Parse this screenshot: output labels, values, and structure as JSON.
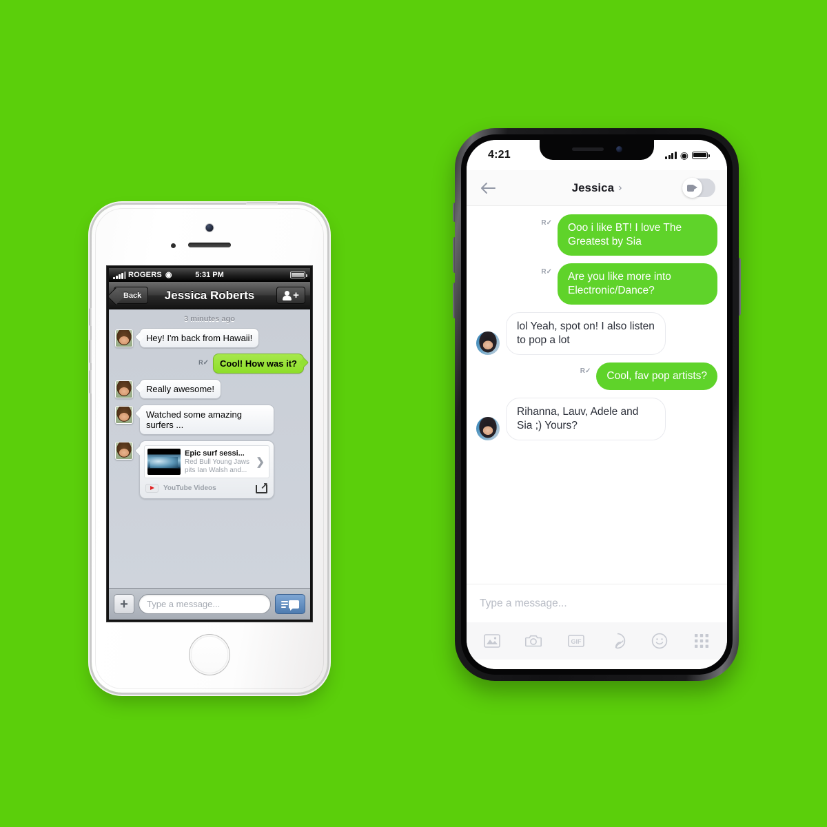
{
  "canvas": {
    "background_color": "#5bcf0b"
  },
  "phone_old": {
    "device_name": "iphone-5s-white",
    "status_bar": {
      "carrier": "ROGERS",
      "wifi_icon": "wifi-icon",
      "time": "5:31 PM",
      "signal_icon": "cellular-signal-icon",
      "battery_icon": "battery-icon"
    },
    "nav": {
      "back_label": "Back",
      "title": "Jessica Roberts",
      "add_contact_icon": "add-person-icon"
    },
    "chat": {
      "timestamp": "3 minutes ago",
      "read_receipt_label": "R",
      "messages": [
        {
          "from": "them",
          "text": "Hey! I'm back from Hawaii!"
        },
        {
          "from": "me",
          "text": "Cool! How was it?"
        },
        {
          "from": "them",
          "text": "Really awesome!"
        },
        {
          "from": "them",
          "text": "Watched some amazing surfers ..."
        }
      ],
      "card": {
        "title": "Epic surf sessi...",
        "desc_line1": "Red Bull Young Jaws",
        "desc_line2": "pits Ian Walsh and...",
        "source": "YouTube Videos",
        "chevron_icon": "chevron-right-icon",
        "play_icon": "youtube-play-icon",
        "share_icon": "share-icon"
      }
    },
    "input_bar": {
      "attach_label": "+",
      "placeholder": "Type a message...",
      "send_icon": "send-message-icon"
    }
  },
  "phone_new": {
    "device_name": "iphone-x-black",
    "status_bar": {
      "time": "4:21",
      "signal_icon": "cellular-signal-icon",
      "wifi_icon": "wifi-icon",
      "battery_icon": "battery-icon"
    },
    "nav": {
      "back_icon": "back-arrow-icon",
      "title": "Jessica",
      "chevron": "›",
      "video_toggle_icon": "video-call-icon",
      "video_toggle_state": "off"
    },
    "chat": {
      "read_receipt_label": "R",
      "messages": [
        {
          "from": "me",
          "text": "Ooo i like BT! I love The Greatest by Sia"
        },
        {
          "from": "me",
          "text": "Are you like more into Electronic/Dance?"
        },
        {
          "from": "them",
          "text": "lol Yeah, spot on! I also listen to pop a lot"
        },
        {
          "from": "me",
          "text": "Cool, fav pop artists?"
        },
        {
          "from": "them",
          "text": "Rihanna, Lauv, Adele and Sia ;) Yours?"
        }
      ]
    },
    "input_bar": {
      "placeholder": "Type a message..."
    },
    "toolbar": {
      "items": [
        {
          "icon": "photo-gallery-icon",
          "label": ""
        },
        {
          "icon": "camera-icon",
          "label": ""
        },
        {
          "icon": "gif-icon",
          "label": "GIF"
        },
        {
          "icon": "sticker-icon",
          "label": ""
        },
        {
          "icon": "emoji-icon",
          "label": ""
        },
        {
          "icon": "apps-grid-icon",
          "label": ""
        }
      ]
    },
    "home_indicator": "home-indicator"
  },
  "colors": {
    "background_green": "#5bcf0b",
    "bubble_green_new": "#5fd32a",
    "bubble_green_old": "#93e035",
    "send_button_blue": "#5f8cc0"
  }
}
